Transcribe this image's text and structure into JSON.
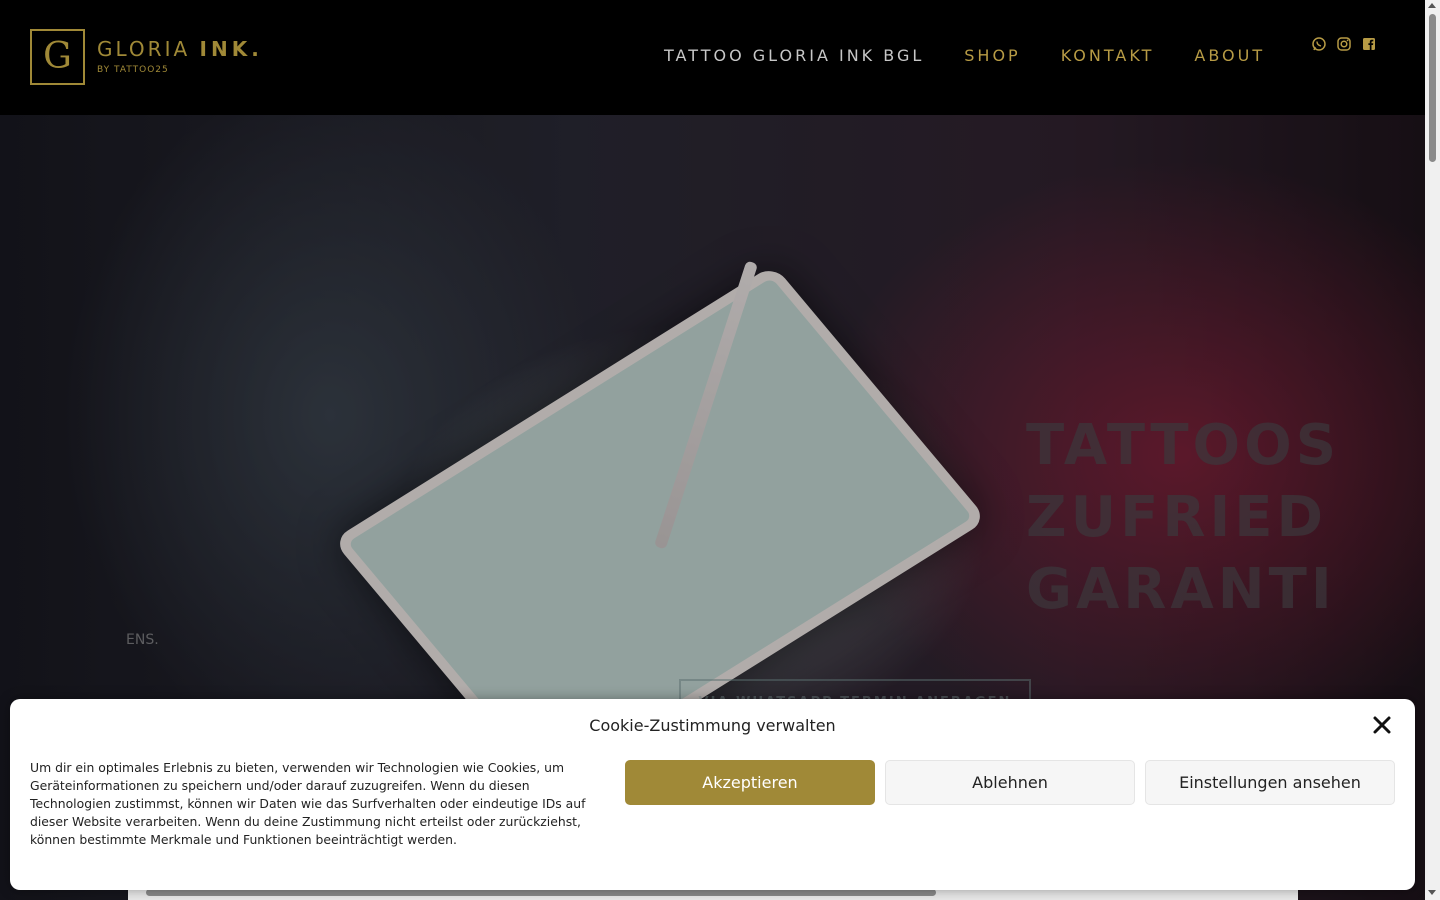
{
  "header": {
    "logo": {
      "letter": "G",
      "name": "GLORIA",
      "name_bold": "INK.",
      "subtitle": "BY TATTOO25"
    },
    "nav": [
      {
        "label": "TATTOO GLORIA INK BGL"
      },
      {
        "label": "SHOP"
      },
      {
        "label": "KONTAKT"
      },
      {
        "label": "ABOUT"
      }
    ],
    "socials": [
      "whatsapp-icon",
      "instagram-icon",
      "facebook-icon"
    ]
  },
  "hero": {
    "title_lines": [
      "TATTOOS",
      "ZUFRIED",
      "GARANTI"
    ],
    "fragment": "ENS.",
    "cta_label": "VIA WHATSAPP TERMIN ANFRAGEN"
  },
  "cookie": {
    "title": "Cookie-Zustimmung verwalten",
    "text": "Um dir ein optimales Erlebnis zu bieten, verwenden wir Technologien wie Cookies, um Geräteinformationen zu speichern und/oder darauf zuzugreifen. Wenn du diesen Technologien zustimmst, können wir Daten wie das Surfverhalten oder eindeutige IDs auf dieser Website verarbeiten. Wenn du deine Zustimmung nicht erteilst oder zurückziehst, können bestimmte Merkmale und Funktionen beeinträchtigt werden.",
    "accept_label": "Akzeptieren",
    "deny_label": "Ablehnen",
    "settings_label": "Einstellungen ansehen"
  },
  "colors": {
    "brand_gold": "#a08937",
    "nav_gold": "#b79b45",
    "header_bg": "#000000"
  }
}
